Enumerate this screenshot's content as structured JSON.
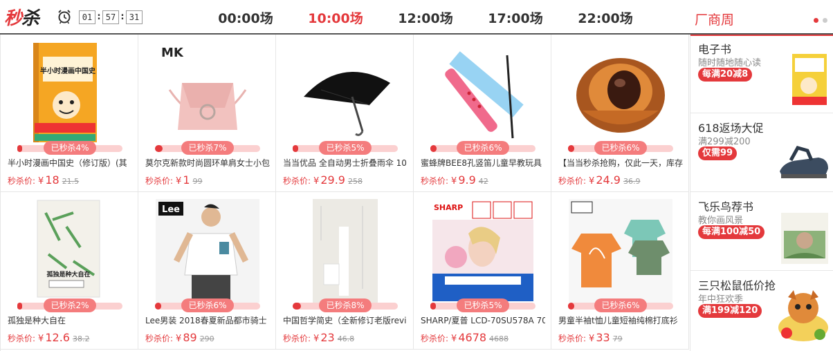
{
  "header": {
    "logo_part1": "秒",
    "logo_part2": "杀",
    "countdown": {
      "hours": "01",
      "minutes": "57",
      "seconds": "31"
    },
    "slots": [
      {
        "label": "00:00场",
        "active": false
      },
      {
        "label": "10:00场",
        "active": true
      },
      {
        "label": "12:00场",
        "active": false
      },
      {
        "label": "17:00场",
        "active": false
      },
      {
        "label": "22:00场",
        "active": false
      }
    ],
    "brand_week": "厂商周"
  },
  "products": [
    {
      "title": "半小时漫画中国史（修订版）(其",
      "sold": "已秒杀4%",
      "sold_pct": 4,
      "price_label": "秒杀价:",
      "currency": "¥",
      "price": "18",
      "old_price": "21.5",
      "icon": "book-cover-icon"
    },
    {
      "title": "莫尔克新款时尚圆环单肩女士小包",
      "sold": "已秒杀7%",
      "sold_pct": 7,
      "price_label": "秒杀价:",
      "currency": "¥",
      "price": "1",
      "old_price": "99",
      "icon": "handbag-icon"
    },
    {
      "title": "当当优品 全自动男士折叠雨伞 10",
      "sold": "已秒杀5%",
      "sold_pct": 5,
      "price_label": "秒杀价:",
      "currency": "¥",
      "price": "29.9",
      "old_price": "258",
      "icon": "umbrella-icon"
    },
    {
      "title": "蜜蜂牌BEE8孔竖笛儿童早教玩具",
      "sold": "已秒杀6%",
      "sold_pct": 6,
      "price_label": "秒杀价:",
      "currency": "¥",
      "price": "9.9",
      "old_price": "42",
      "icon": "recorder-flute-icon"
    },
    {
      "title": "【当当秒杀抢购，仅此一天，库存",
      "sold": "已秒杀6%",
      "sold_pct": 6,
      "price_label": "秒杀价:",
      "currency": "¥",
      "price": "24.9",
      "old_price": "36.9",
      "icon": "longan-fruit-icon"
    },
    {
      "title": "孤独是种大自在",
      "sold": "已秒杀2%",
      "sold_pct": 2,
      "price_label": "秒杀价:",
      "currency": "¥",
      "price": "12.6",
      "old_price": "38.2",
      "icon": "book-cover-icon"
    },
    {
      "title": "Lee男装 2018春夏新品都市骑士",
      "sold": "已秒杀6%",
      "sold_pct": 6,
      "price_label": "秒杀价:",
      "currency": "¥",
      "price": "89",
      "old_price": "290",
      "icon": "tshirt-model-icon"
    },
    {
      "title": "中国哲学简史（全新修订老版revi",
      "sold": "已秒杀8%",
      "sold_pct": 8,
      "price_label": "秒杀价:",
      "currency": "¥",
      "price": "23",
      "old_price": "46.8",
      "icon": "book-cover-icon"
    },
    {
      "title": "SHARP/夏普 LCD-70SU578A 70",
      "sold": "已秒杀5%",
      "sold_pct": 5,
      "price_label": "秒杀价:",
      "currency": "¥",
      "price": "4678",
      "old_price": "4688",
      "icon": "television-icon"
    },
    {
      "title": "男童半袖t恤儿童短袖纯棉打底衫",
      "sold": "已秒杀6%",
      "sold_pct": 6,
      "price_label": "秒杀价:",
      "currency": "¥",
      "price": "33",
      "old_price": "79",
      "icon": "kids-tshirt-icon"
    }
  ],
  "product_image_text": {
    "book1_title": "半小时漫画中国史",
    "bag_brand": "MK",
    "lee": "Lee",
    "book2_title": "孤独是种大自在",
    "sharp": "SHARP"
  },
  "side_promos": [
    {
      "title": "电子书",
      "subtitle": "随时随地随心读",
      "badge": "每满20减8",
      "icon": "ebook-icon"
    },
    {
      "title": "618返场大促",
      "subtitle": "满299减200",
      "badge": "仅需99",
      "icon": "sandal-icon"
    },
    {
      "title": "飞乐鸟荐书",
      "subtitle": "教你画风景",
      "badge": "每满100减50",
      "icon": "art-book-icon"
    },
    {
      "title": "三只松鼠低价抢",
      "subtitle": "年中狂欢季",
      "badge": "满199减120",
      "icon": "squirrel-snacks-icon"
    }
  ],
  "colors": {
    "accent": "#e4393c",
    "progress_track": "#fbd0d0",
    "badge": "#f47c7d"
  }
}
